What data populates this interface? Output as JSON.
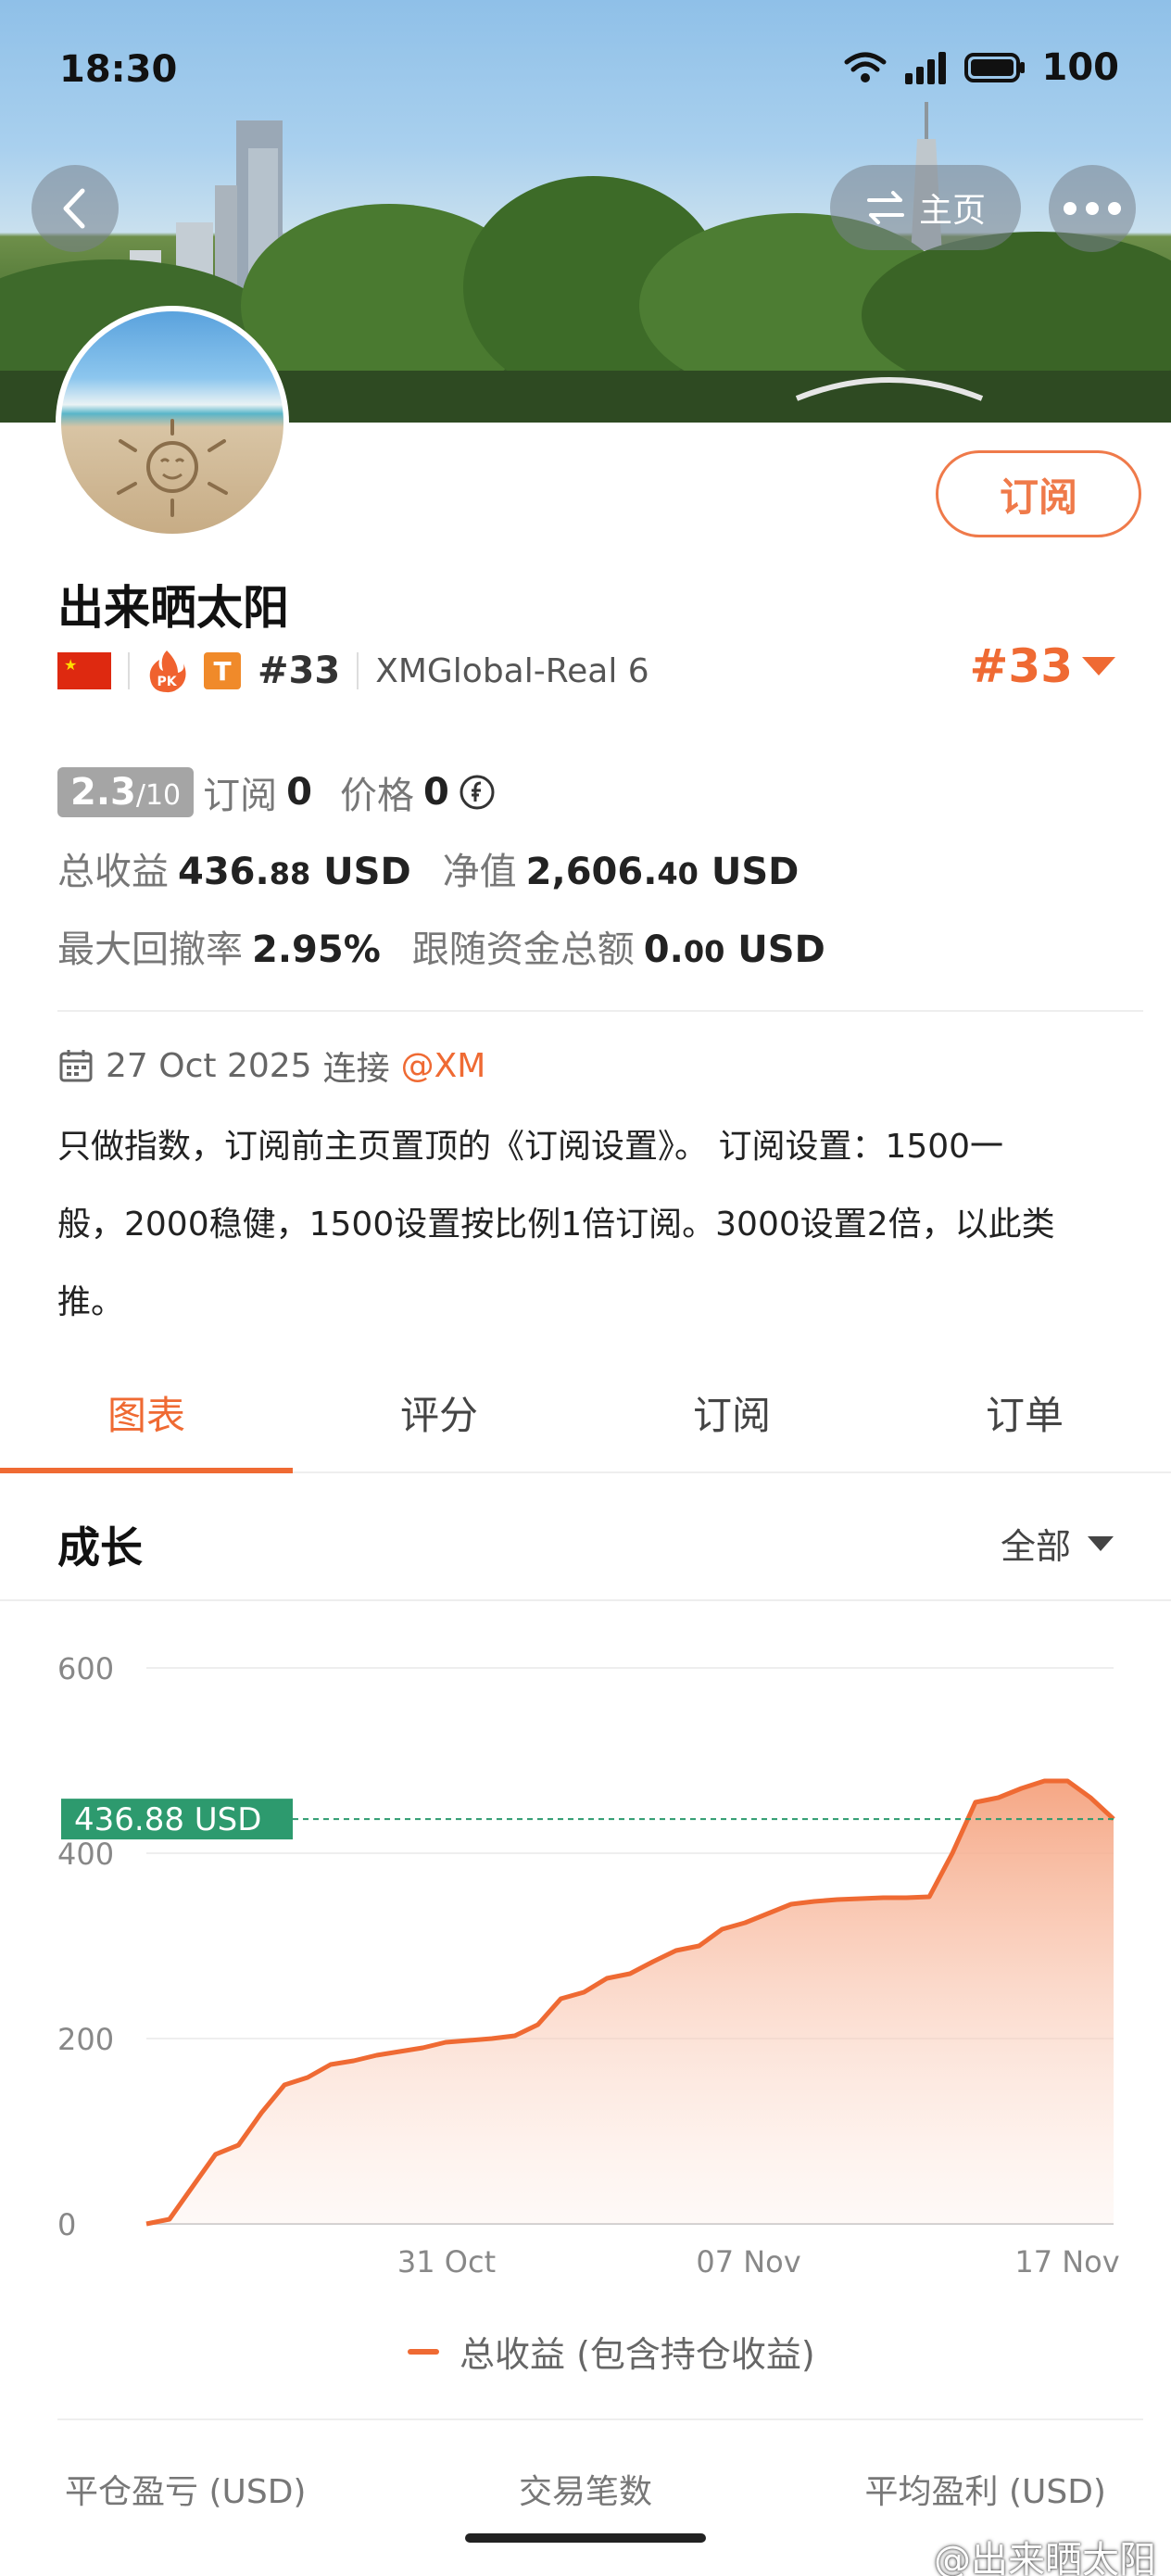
{
  "status_bar": {
    "time": "18:30",
    "battery": "100"
  },
  "header": {
    "back_label": "<",
    "home_label": "主页",
    "more_label": "•••"
  },
  "profile": {
    "subscribe_label": "订阅",
    "name": "出来晒太阳",
    "flag_icon": "china-flag-icon",
    "pk_badge": "PK",
    "t_badge": "T",
    "rank_small": "#33",
    "broker": "XMGlobal-Real 6",
    "rank_big": "#33"
  },
  "stats": {
    "score_main": "2.3",
    "score_den": "/10",
    "subscribe_label": "订阅",
    "subscribe_count": "0",
    "price_label": "价格",
    "price_value": "0",
    "total_profit_label": "总收益",
    "total_profit_int": "436.",
    "total_profit_dec": "88",
    "total_profit_unit": "USD",
    "equity_label": "净值",
    "equity_int": "2,606.",
    "equity_dec": "40",
    "equity_unit": "USD",
    "drawdown_label": "最大回撤率",
    "drawdown_value": "2.95%",
    "follow_label": "跟随资金总额",
    "follow_int": "0.",
    "follow_dec": "00",
    "follow_unit": "USD"
  },
  "info": {
    "since_date": "27 Oct 2025",
    "since_text": "连接",
    "since_at": "@XM",
    "bio_lines": [
      "只做指数，订阅前主页置顶的《订阅设置》。 订阅设置：1500一",
      "般，2000稳健，1500设置按比例1倍订阅。3000设置2倍，以此类",
      "推。"
    ]
  },
  "tabs": [
    {
      "label": "图表",
      "active": true
    },
    {
      "label": "评分",
      "active": false
    },
    {
      "label": "订阅",
      "active": false
    },
    {
      "label": "订单",
      "active": false
    }
  ],
  "section": {
    "title": "成长",
    "range_label": "全部"
  },
  "chart_data": {
    "type": "area",
    "y_ticks": [
      "600",
      "400",
      "200",
      "0"
    ],
    "ylim": [
      0,
      600
    ],
    "x_tick_labels": [
      "31 Oct",
      "07 Nov",
      "17 Nov"
    ],
    "current_label": "436.88 USD",
    "current_value": 436.88,
    "series": [
      {
        "name": "总收益 (包含持仓收益)",
        "values": [
          0,
          5,
          40,
          75,
          85,
          120,
          150,
          158,
          172,
          176,
          182,
          186,
          190,
          196,
          198,
          200,
          203,
          215,
          243,
          250,
          265,
          270,
          283,
          295,
          300,
          318,
          325,
          335,
          345,
          348,
          350,
          351,
          352,
          352,
          353,
          400,
          455,
          460,
          470,
          478,
          478,
          460,
          436.88
        ]
      }
    ],
    "color": "#ef6a33"
  },
  "bottom_stats_labels": [
    "平仓盈亏 (USD)",
    "交易笔数",
    "平均盈利 (USD)"
  ],
  "watermark": "@出来晒太阳"
}
